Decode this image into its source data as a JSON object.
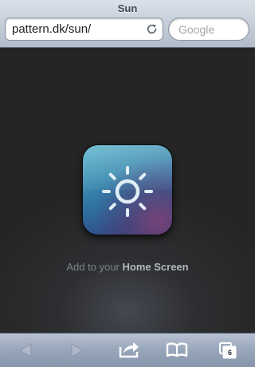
{
  "browser": {
    "page_title": "Sun",
    "url": "pattern.dk/sun/",
    "search_placeholder": "Google"
  },
  "content": {
    "caption_prefix": "Add to your ",
    "caption_bold": "Home Screen"
  },
  "toolbar": {
    "open_tabs_count": "6",
    "buttons": [
      "back-icon",
      "forward-icon",
      "share-icon",
      "bookmarks-icon",
      "tabs-icon"
    ]
  },
  "colors": {
    "background": "#232323",
    "icon_teal": "#4fb0c8",
    "icon_purple": "#804278",
    "toolbar_blue": "#98a6ba"
  }
}
